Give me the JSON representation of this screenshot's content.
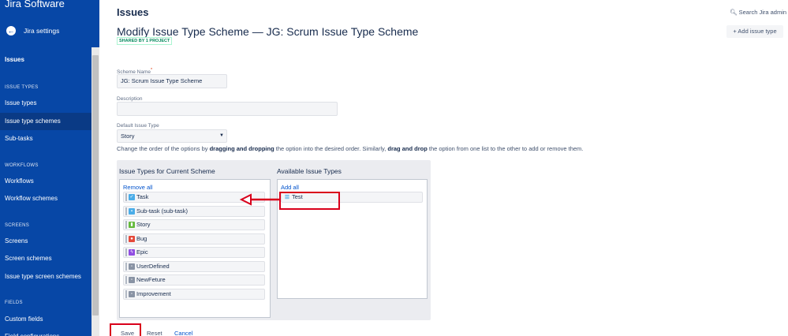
{
  "sidebar": {
    "brand": "Jira Software",
    "back_label": "Jira settings",
    "top_item": "Issues",
    "sections": [
      {
        "title": "ISSUE TYPES",
        "items": [
          "Issue types",
          "Issue type schemes",
          "Sub-tasks"
        ]
      },
      {
        "title": "WORKFLOWS",
        "items": [
          "Workflows",
          "Workflow schemes"
        ]
      },
      {
        "title": "SCREENS",
        "items": [
          "Screens",
          "Screen schemes",
          "Issue type screen schemes"
        ]
      },
      {
        "title": "FIELDS",
        "items": [
          "Custom fields",
          "Field configurations"
        ]
      }
    ],
    "active_item": "Issue type schemes",
    "accent": "#0747a6"
  },
  "header": {
    "page_title": "Issues",
    "search_placeholder": "Search Jira admin",
    "title": "Modify Issue Type Scheme — JG: Scrum Issue Type Scheme",
    "lozenge": "SHARED BY 1 PROJECT",
    "add_issue_type": "Add issue type"
  },
  "form": {
    "scheme_name_label": "Scheme Name",
    "scheme_name_required": "*",
    "scheme_name_value": "JG: Scrum Issue Type Scheme",
    "description_label": "Description",
    "description_value": "",
    "default_type_label": "Default Issue Type",
    "default_type_value": "Story",
    "help_parts": [
      "Change the order of the options by ",
      "dragging and dropping",
      " the option into the desired order. Similarly, ",
      "drag and drop",
      " the option from one list to the other to add or remove them."
    ]
  },
  "current_scheme": {
    "title": "Issue Types for Current Scheme",
    "remove_all": "Remove all",
    "items": [
      {
        "label": "Task",
        "icon": "task-icon",
        "color": "#4bade8",
        "glyph": "✓"
      },
      {
        "label": "Sub-task (sub-task)",
        "icon": "subtask-icon",
        "color": "#4bade8",
        "glyph": "▪"
      },
      {
        "label": "Story",
        "icon": "story-icon",
        "color": "#63ba3c",
        "glyph": "▮"
      },
      {
        "label": "Bug",
        "icon": "bug-icon",
        "color": "#e5493a",
        "glyph": "●"
      },
      {
        "label": "Epic",
        "icon": "epic-icon",
        "color": "#904ee2",
        "glyph": "ϟ"
      },
      {
        "label": "UserDefined",
        "icon": "generic-issue-icon",
        "color": "#8993a4",
        "glyph": "▫"
      },
      {
        "label": "NewFeture",
        "icon": "generic-issue-icon",
        "color": "#8993a4",
        "glyph": "▫"
      },
      {
        "label": "Improvement",
        "icon": "generic-issue-icon",
        "color": "#8993a4",
        "glyph": "▫"
      }
    ]
  },
  "available": {
    "title": "Available Issue Types",
    "add_all": "Add all",
    "items": [
      {
        "label": "Test",
        "icon": "test-icon",
        "color": "#4bade8"
      }
    ]
  },
  "actions": {
    "save": "Save",
    "reset": "Reset",
    "cancel": "Cancel"
  },
  "annotation_color": "#d9001b"
}
